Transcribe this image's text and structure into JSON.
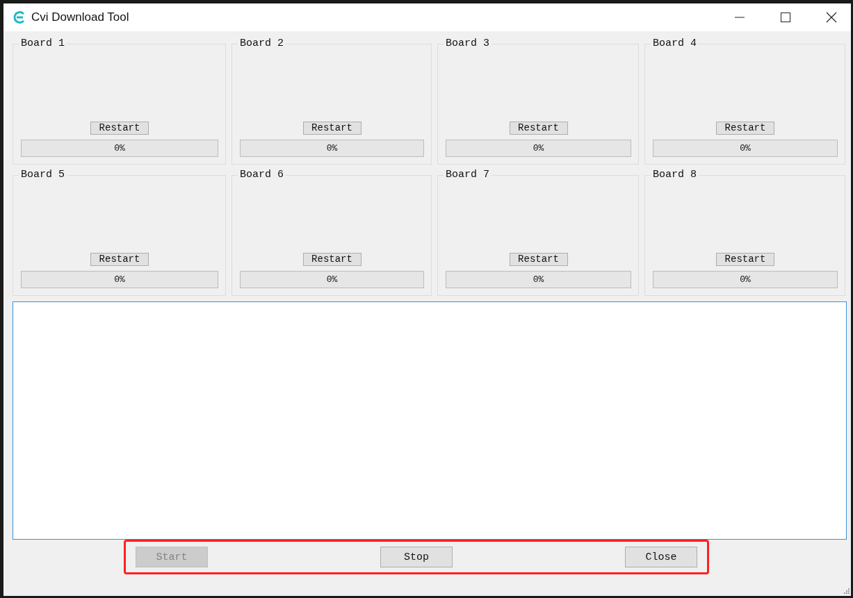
{
  "window": {
    "title": "Cvi Download Tool"
  },
  "boards": [
    {
      "label": "Board 1",
      "button": "Restart",
      "level": 0,
      "reading": "0%"
    },
    {
      "label": "Board 2",
      "button": "Restart",
      "level": 0,
      "reading": "0%"
    },
    {
      "label": "Board 3",
      "button": "Restart",
      "level": 0,
      "reading": "0%"
    },
    {
      "label": "Board 4",
      "button": "Restart",
      "level": 0,
      "reading": "0%"
    },
    {
      "label": "Board 5",
      "button": "Restart",
      "level": 0,
      "reading": "0%"
    },
    {
      "label": "Board 6",
      "button": "Restart",
      "level": 0,
      "reading": "0%"
    },
    {
      "label": "Board 7",
      "button": "Restart",
      "level": 0,
      "reading": "0%"
    },
    {
      "label": "Board 8",
      "button": "Restart",
      "level": 0,
      "reading": "0%"
    }
  ],
  "log": {
    "focused": true
  },
  "buttons": [
    {
      "label": "Start",
      "disabled": true
    },
    {
      "label": "Stop",
      "disabled": false
    },
    {
      "label": "Close",
      "disabled": false
    }
  ],
  "button_bar": {
    "highlighted": true
  }
}
